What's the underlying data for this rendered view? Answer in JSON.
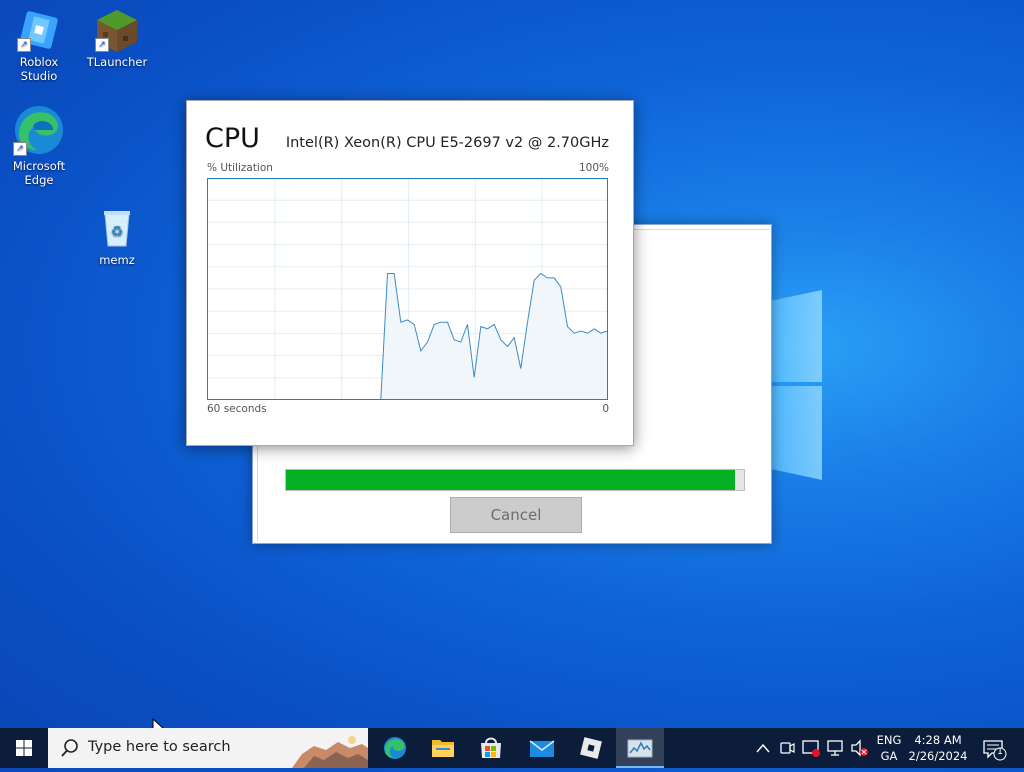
{
  "desktop": {
    "icons": [
      {
        "label": "Roblox Studio"
      },
      {
        "label": "TLauncher"
      },
      {
        "label": "Microsoft Edge"
      },
      {
        "label": "memz"
      }
    ]
  },
  "dialog": {
    "progress": 0.98,
    "cancel_label": "Cancel"
  },
  "cpu_window": {
    "title": "CPU",
    "model": "Intel(R) Xeon(R) CPU E5-2697 v2 @ 2.70GHz",
    "y_label": "% Utilization",
    "y_max_label": "100%",
    "x_label": "60 seconds",
    "x_min_label": "0"
  },
  "chart_data": {
    "type": "area",
    "title": "CPU",
    "xlabel": "60 seconds",
    "ylabel": "% Utilization",
    "ylim": [
      0,
      100
    ],
    "x": [
      60,
      59,
      58,
      57,
      56,
      55,
      54,
      53,
      52,
      51,
      50,
      49,
      48,
      47,
      46,
      45,
      44,
      43,
      42,
      41,
      40,
      39,
      38,
      37,
      36,
      35,
      34,
      33,
      32,
      31,
      30,
      29,
      28,
      27,
      26,
      25,
      24,
      23,
      22,
      21,
      20,
      19,
      18,
      17,
      16,
      15,
      14,
      13,
      12,
      11,
      10,
      9,
      8,
      7,
      6,
      5,
      4,
      3,
      2,
      1,
      0
    ],
    "series": [
      {
        "color": "#3a8cc6",
        "values": [
          0,
          0,
          0,
          0,
          0,
          0,
          0,
          0,
          0,
          0,
          0,
          0,
          0,
          0,
          0,
          0,
          0,
          0,
          0,
          0,
          0,
          0,
          0,
          0,
          0,
          0,
          0,
          57,
          57,
          35,
          36,
          34,
          22,
          26,
          34,
          35,
          35,
          27,
          26,
          34,
          10,
          33,
          32,
          34,
          27,
          24,
          28,
          14,
          35,
          54,
          57,
          55,
          55,
          51,
          33,
          30,
          31,
          30,
          32,
          30,
          31
        ]
      }
    ]
  },
  "taskbar": {
    "search_placeholder": "Type here to search",
    "language_top": "ENG",
    "language_bottom": "GA",
    "time": "4:28 AM",
    "date": "2/26/2024",
    "notification_count": "1"
  }
}
